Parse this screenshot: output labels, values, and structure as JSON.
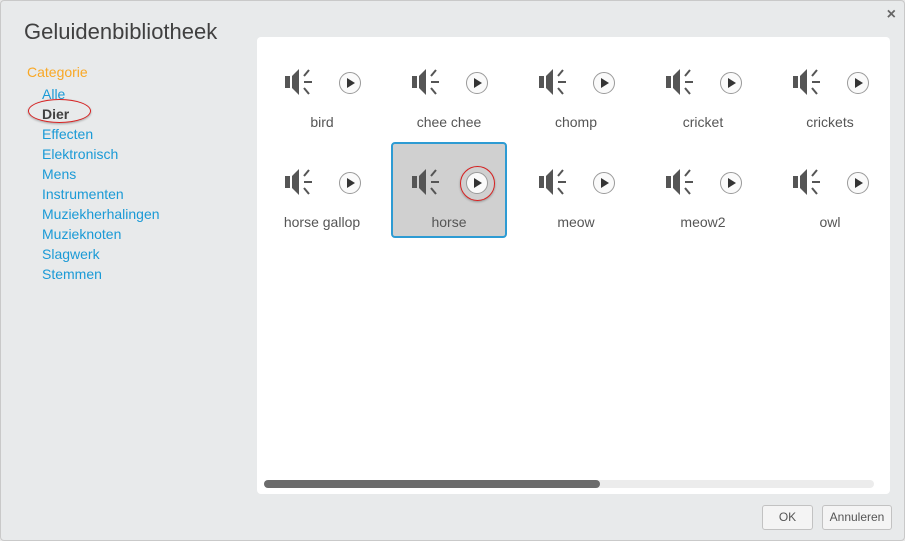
{
  "dialog": {
    "title": "Geluidenbibliotheek",
    "close_icon": "×"
  },
  "categories": {
    "header": "Categorie",
    "items": [
      {
        "label": "Alle",
        "selected": false
      },
      {
        "label": "Dier",
        "selected": true
      },
      {
        "label": "Effecten",
        "selected": false
      },
      {
        "label": "Elektronisch",
        "selected": false
      },
      {
        "label": "Mens",
        "selected": false
      },
      {
        "label": "Instrumenten",
        "selected": false
      },
      {
        "label": "Muziekherhalingen",
        "selected": false
      },
      {
        "label": "Muzieknoten",
        "selected": false
      },
      {
        "label": "Slagwerk",
        "selected": false
      },
      {
        "label": "Stemmen",
        "selected": false
      }
    ]
  },
  "sounds": [
    {
      "label": "bird",
      "selected": false
    },
    {
      "label": "chee chee",
      "selected": false
    },
    {
      "label": "chomp",
      "selected": false
    },
    {
      "label": "cricket",
      "selected": false
    },
    {
      "label": "crickets",
      "selected": false
    },
    {
      "label": "horse gallop",
      "selected": false
    },
    {
      "label": "horse",
      "selected": true
    },
    {
      "label": "meow",
      "selected": false
    },
    {
      "label": "meow2",
      "selected": false
    },
    {
      "label": "owl",
      "selected": false
    }
  ],
  "scrollbar": {
    "position_fraction": 0.55
  },
  "footer": {
    "ok_label": "OK",
    "cancel_label": "Annuleren"
  },
  "colors": {
    "accent": "#1a9ad6",
    "category_header": "#f9a825",
    "selected_border": "#2d9bd3",
    "highlight_ring": "#d62020"
  }
}
